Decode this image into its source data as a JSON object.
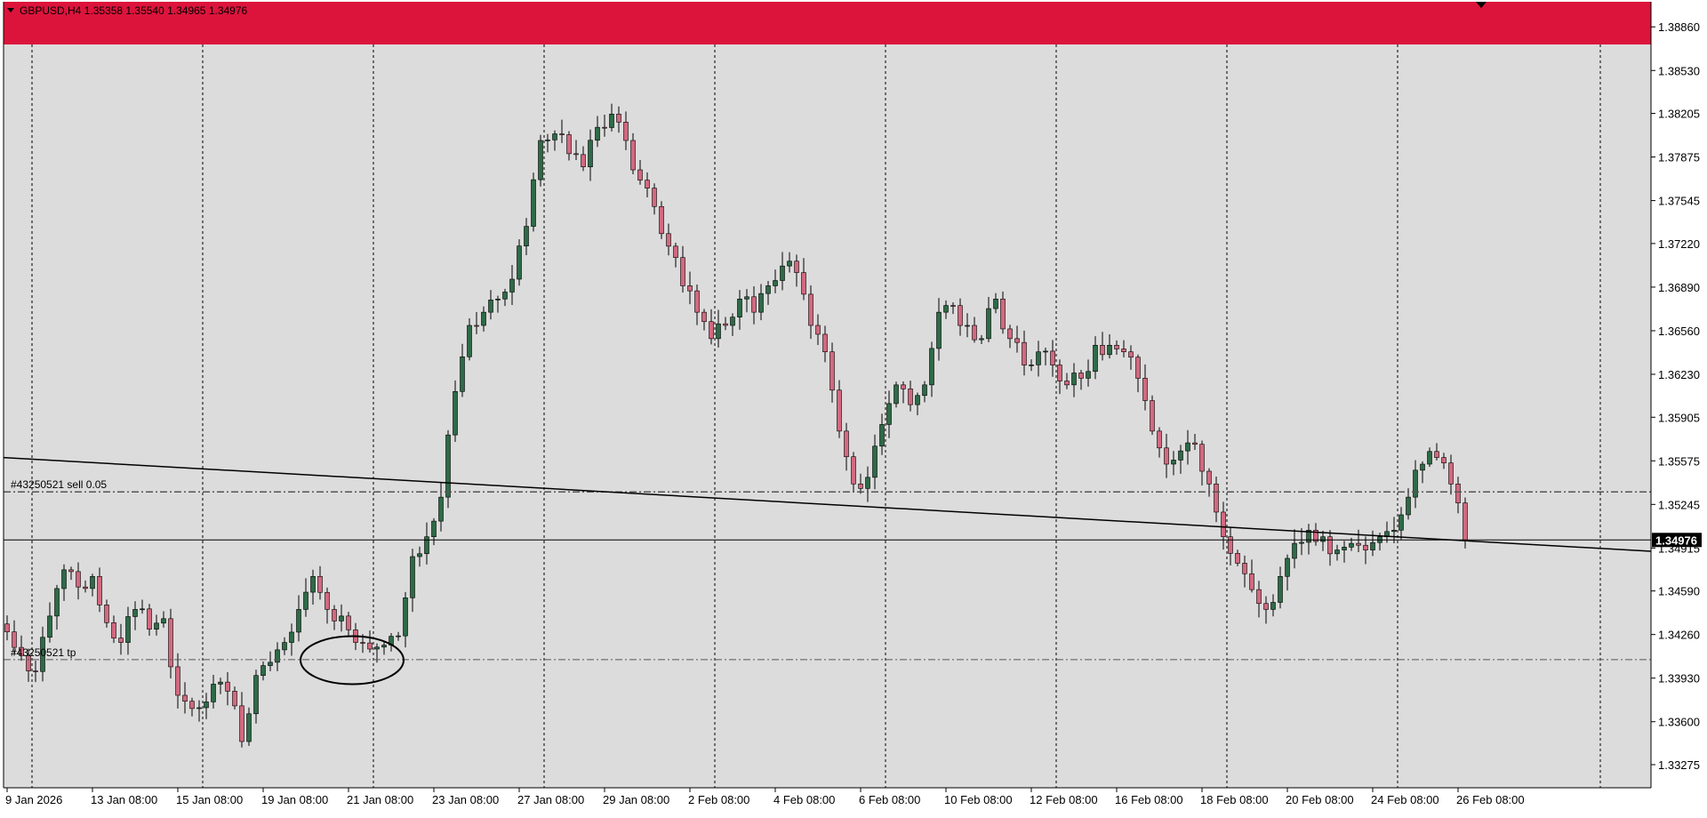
{
  "colors": {
    "background": "#dcdcdc",
    "bull": "#2e6b47",
    "bear": "#d2697f",
    "wick": "#000000",
    "banner": "#dc143c",
    "grid": "#000000",
    "axis_bg": "#ffffff",
    "current_price_bg": "#000000"
  },
  "header": {
    "symbol_text": "GBPUSD,H4  1.35358 1.35540 1.34965 1.34976",
    "dropdown_icon": "triangle-down-icon",
    "shift_marker_icon": "triangle-down-icon"
  },
  "orders": {
    "sell_label": "#43250521 sell 0.05",
    "tp_label": "#43250521 tp",
    "sell_price": 1.3534,
    "tp_price": 1.3407
  },
  "annotation": {
    "shape": "ellipse",
    "center_price": 1.3416,
    "candle_index": 47
  },
  "trendline": {
    "start_price": 1.356,
    "end_price": 1.3489,
    "end_candle_index": 221
  },
  "chart_data": {
    "type": "candlestick",
    "symbol": "GBPUSD",
    "timeframe": "H4",
    "last_close": 1.34976,
    "current_price_label": "1.34976",
    "ylim": [
      1.331,
      1.3905
    ],
    "price_ticks": [
      1.3886,
      1.3853,
      1.38205,
      1.37875,
      1.37545,
      1.3722,
      1.3689,
      1.3656,
      1.3623,
      1.35905,
      1.35575,
      1.35245,
      1.34915,
      1.3459,
      1.3426,
      1.3393,
      1.336,
      1.33275
    ],
    "price_tick_labels": [
      "1.38860",
      "1.38530",
      "1.38205",
      "1.37875",
      "1.37545",
      "1.37220",
      "1.36890",
      "1.36560",
      "1.36230",
      "1.35905",
      "1.35575",
      "1.35245",
      "1.34915",
      "1.34590",
      "1.34260",
      "1.33930",
      "1.33600",
      "1.33275"
    ],
    "date_ticks": [
      {
        "label": "9 Jan 2026",
        "index": 0
      },
      {
        "label": "13 Jan 08:00",
        "index": 12
      },
      {
        "label": "15 Jan 08:00",
        "index": 24
      },
      {
        "label": "19 Jan 08:00",
        "index": 36
      },
      {
        "label": "21 Jan 08:00",
        "index": 48
      },
      {
        "label": "23 Jan 08:00",
        "index": 60
      },
      {
        "label": "27 Jan 08:00",
        "index": 72
      },
      {
        "label": "29 Jan 08:00",
        "index": 84
      },
      {
        "label": "2 Feb 08:00",
        "index": 96
      },
      {
        "label": "4 Feb 08:00",
        "index": 108
      },
      {
        "label": "6 Feb 08:00",
        "index": 120
      },
      {
        "label": "10 Feb 08:00",
        "index": 132
      },
      {
        "label": "12 Feb 08:00",
        "index": 144
      },
      {
        "label": "16 Feb 08:00",
        "index": 156
      },
      {
        "label": "18 Feb 08:00",
        "index": 168
      },
      {
        "label": "20 Feb 08:00",
        "index": 180
      },
      {
        "label": "24 Feb 08:00",
        "index": 192
      },
      {
        "label": "26 Feb 08:00",
        "index": 204
      }
    ],
    "vertical_grid_indices": [
      3.5,
      27.5,
      51.5,
      75.5,
      99.5,
      123.5,
      147.5,
      171.5,
      195.5,
      224
    ],
    "total_slots": 230,
    "anchors": [
      [
        0,
        1.3428
      ],
      [
        2,
        1.341
      ],
      [
        4,
        1.3398
      ],
      [
        6,
        1.344
      ],
      [
        8,
        1.3475
      ],
      [
        10,
        1.3462
      ],
      [
        12,
        1.347
      ],
      [
        14,
        1.3435
      ],
      [
        16,
        1.342
      ],
      [
        18,
        1.3445
      ],
      [
        20,
        1.343
      ],
      [
        22,
        1.3438
      ],
      [
        24,
        1.338
      ],
      [
        26,
        1.337
      ],
      [
        28,
        1.3375
      ],
      [
        30,
        1.339
      ],
      [
        32,
        1.3372
      ],
      [
        33,
        1.3345
      ],
      [
        35,
        1.3395
      ],
      [
        37,
        1.3405
      ],
      [
        39,
        1.342
      ],
      [
        41,
        1.3445
      ],
      [
        43,
        1.347
      ],
      [
        45,
        1.3445
      ],
      [
        47,
        1.344
      ],
      [
        49,
        1.342
      ],
      [
        51,
        1.3415
      ],
      [
        53,
        1.3418
      ],
      [
        55,
        1.3425
      ],
      [
        57,
        1.3485
      ],
      [
        59,
        1.35
      ],
      [
        61,
        1.353
      ],
      [
        63,
        1.361
      ],
      [
        65,
        1.366
      ],
      [
        67,
        1.367
      ],
      [
        69,
        1.368
      ],
      [
        71,
        1.3695
      ],
      [
        73,
        1.3735
      ],
      [
        75,
        1.38
      ],
      [
        77,
        1.3805
      ],
      [
        79,
        1.379
      ],
      [
        81,
        1.378
      ],
      [
        83,
        1.381
      ],
      [
        85,
        1.382
      ],
      [
        87,
        1.38
      ],
      [
        89,
        1.377
      ],
      [
        91,
        1.375
      ],
      [
        93,
        1.372
      ],
      [
        95,
        1.369
      ],
      [
        97,
        1.367
      ],
      [
        99,
        1.365
      ],
      [
        101,
        1.366
      ],
      [
        103,
        1.368
      ],
      [
        105,
        1.367
      ],
      [
        107,
        1.369
      ],
      [
        109,
        1.3705
      ],
      [
        111,
        1.37
      ],
      [
        113,
        1.366
      ],
      [
        115,
        1.364
      ],
      [
        117,
        1.358
      ],
      [
        119,
        1.354
      ],
      [
        121,
        1.3545
      ],
      [
        123,
        1.3585
      ],
      [
        125,
        1.3615
      ],
      [
        127,
        1.36
      ],
      [
        129,
        1.3615
      ],
      [
        131,
        1.367
      ],
      [
        133,
        1.3675
      ],
      [
        135,
        1.366
      ],
      [
        137,
        1.365
      ],
      [
        139,
        1.368
      ],
      [
        141,
        1.365
      ],
      [
        143,
        1.363
      ],
      [
        145,
        1.364
      ],
      [
        147,
        1.363
      ],
      [
        149,
        1.3615
      ],
      [
        151,
        1.362
      ],
      [
        153,
        1.3645
      ],
      [
        155,
        1.3645
      ],
      [
        157,
        1.364
      ],
      [
        159,
        1.362
      ],
      [
        161,
        1.358
      ],
      [
        163,
        1.3555
      ],
      [
        165,
        1.3565
      ],
      [
        167,
        1.357
      ],
      [
        169,
        1.354
      ],
      [
        171,
        1.35
      ],
      [
        173,
        1.348
      ],
      [
        175,
        1.346
      ],
      [
        177,
        1.3445
      ],
      [
        179,
        1.347
      ],
      [
        181,
        1.3495
      ],
      [
        183,
        1.3505
      ],
      [
        185,
        1.35
      ],
      [
        187,
        1.349
      ],
      [
        189,
        1.3495
      ],
      [
        191,
        1.349
      ],
      [
        193,
        1.35
      ],
      [
        195,
        1.3505
      ],
      [
        197,
        1.353
      ],
      [
        199,
        1.3555
      ],
      [
        201,
        1.356
      ],
      [
        203,
        1.354
      ],
      [
        205,
        1.3498
      ]
    ]
  }
}
